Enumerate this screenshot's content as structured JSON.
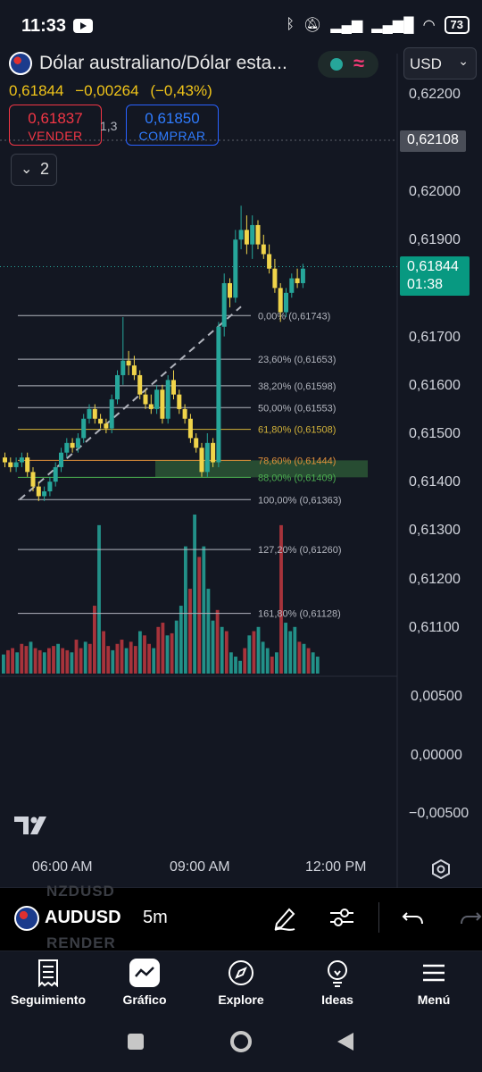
{
  "status_bar": {
    "time": "11:33",
    "battery": "73",
    "icons": [
      "youtube-icon",
      "bluetooth-icon",
      "mute-icon",
      "signal-icon",
      "signal-icon",
      "wifi-icon",
      "battery-icon"
    ]
  },
  "header": {
    "symbol_title": "Dólar australiano/Dólar esta...",
    "currency": "USD",
    "last_price": "0,61844",
    "change": "−0,00264",
    "change_pct": "(−0,43%)",
    "sell_price": "0,61837",
    "sell_label": "VENDER",
    "spread": "1,3",
    "buy_price": "0,61850",
    "buy_label": "COMPRAR",
    "collapsed_count": "2"
  },
  "y_axis": {
    "labels": [
      "0,62200",
      "0,62000",
      "0,61900",
      "0,61700",
      "0,61600",
      "0,61500",
      "0,61400",
      "0,61300",
      "0,61200",
      "0,61100"
    ],
    "marker_grey": "0,62108",
    "marker_price": "0,61844",
    "marker_timer": "01:38",
    "osc_labels": [
      "0,00500",
      "0,00000",
      "−0,00500"
    ]
  },
  "fibonacci": {
    "levels": [
      {
        "label": "0,00% (0,61743)",
        "value": 0.61743,
        "color": "#b2b5be"
      },
      {
        "label": "23,60% (0,61653)",
        "value": 0.61653,
        "color": "#b2b5be"
      },
      {
        "label": "38,20% (0,61598)",
        "value": 0.61598,
        "color": "#b2b5be"
      },
      {
        "label": "50,00% (0,61553)",
        "value": 0.61553,
        "color": "#b2b5be"
      },
      {
        "label": "61,80% (0,61508)",
        "value": 0.61508,
        "color": "#d4b43a"
      },
      {
        "label": "78,60% (0,61444)",
        "value": 0.61444,
        "color": "#e0903a"
      },
      {
        "label": "88,00% (0,61409)",
        "value": 0.61409,
        "color": "#4caf50"
      },
      {
        "label": "100,00% (0,61363)",
        "value": 0.61363,
        "color": "#b2b5be"
      },
      {
        "label": "127,20% (0,61260)",
        "value": 0.6126,
        "color": "#b2b5be"
      },
      {
        "label": "161,80% (0,61128)",
        "value": 0.61128,
        "color": "#b2b5be"
      }
    ]
  },
  "time_axis": [
    "06:00 AM",
    "09:00 AM",
    "12:00 PM"
  ],
  "symbol_bar": {
    "ghost_top": "NZDUSD",
    "symbol": "AUDUSD",
    "ghost_bottom": "RENDER",
    "interval": "5m"
  },
  "nav": {
    "items": [
      {
        "label": "Seguimiento",
        "icon": "watchlist-icon"
      },
      {
        "label": "Gráfico",
        "icon": "chart-icon"
      },
      {
        "label": "Explore",
        "icon": "compass-icon"
      },
      {
        "label": "Ideas",
        "icon": "lightbulb-icon"
      },
      {
        "label": "Menú",
        "icon": "menu-icon"
      }
    ]
  },
  "colors": {
    "up": "#26a69a",
    "down": "#f0d44a",
    "volume_up": "#26a69a",
    "volume_down": "#c2383f",
    "accent": "#2962ff"
  },
  "chart_data": {
    "type": "candlestick",
    "interval": "5m",
    "y_range": [
      0.6106,
      0.6225
    ],
    "candles": [
      [
        0.6145,
        0.6146,
        0.6143,
        0.6144
      ],
      [
        0.6144,
        0.6145,
        0.6142,
        0.6143
      ],
      [
        0.6143,
        0.6145,
        0.6142,
        0.6144
      ],
      [
        0.6144,
        0.6146,
        0.6143,
        0.6145
      ],
      [
        0.6145,
        0.6146,
        0.6141,
        0.6142
      ],
      [
        0.6142,
        0.6143,
        0.6138,
        0.6139
      ],
      [
        0.6139,
        0.614,
        0.6136,
        0.6137
      ],
      [
        0.6137,
        0.6139,
        0.6136,
        0.6138
      ],
      [
        0.6138,
        0.6141,
        0.6137,
        0.614
      ],
      [
        0.614,
        0.6144,
        0.6139,
        0.6143
      ],
      [
        0.6143,
        0.6147,
        0.6142,
        0.6146
      ],
      [
        0.6146,
        0.6149,
        0.6145,
        0.6148
      ],
      [
        0.6148,
        0.6149,
        0.6146,
        0.6147
      ],
      [
        0.6147,
        0.615,
        0.6146,
        0.6149
      ],
      [
        0.6149,
        0.6154,
        0.6148,
        0.6153
      ],
      [
        0.6153,
        0.6156,
        0.6152,
        0.6155
      ],
      [
        0.6155,
        0.6156,
        0.6152,
        0.6153
      ],
      [
        0.6153,
        0.6154,
        0.6151,
        0.6152
      ],
      [
        0.6152,
        0.6153,
        0.615,
        0.6151
      ],
      [
        0.6151,
        0.6158,
        0.615,
        0.6157
      ],
      [
        0.6157,
        0.6163,
        0.6156,
        0.6162
      ],
      [
        0.6162,
        0.6174,
        0.616,
        0.6165
      ],
      [
        0.6165,
        0.6167,
        0.6162,
        0.6164
      ],
      [
        0.6164,
        0.6166,
        0.6161,
        0.6162
      ],
      [
        0.6162,
        0.6163,
        0.6157,
        0.6158
      ],
      [
        0.6158,
        0.6159,
        0.6155,
        0.6156
      ],
      [
        0.6156,
        0.6158,
        0.6154,
        0.6155
      ],
      [
        0.6155,
        0.616,
        0.6154,
        0.6159
      ],
      [
        0.6159,
        0.616,
        0.6152,
        0.6153
      ],
      [
        0.6153,
        0.6162,
        0.6152,
        0.6161
      ],
      [
        0.6161,
        0.6163,
        0.6157,
        0.6158
      ],
      [
        0.6158,
        0.6159,
        0.6154,
        0.6155
      ],
      [
        0.6155,
        0.6156,
        0.6152,
        0.6153
      ],
      [
        0.6153,
        0.6154,
        0.6148,
        0.6149
      ],
      [
        0.6149,
        0.615,
        0.6146,
        0.6147
      ],
      [
        0.6147,
        0.6148,
        0.6141,
        0.6142
      ],
      [
        0.6142,
        0.615,
        0.6141,
        0.6148
      ],
      [
        0.6148,
        0.6149,
        0.6143,
        0.6144
      ],
      [
        0.6144,
        0.6173,
        0.6143,
        0.6172
      ],
      [
        0.6172,
        0.6183,
        0.617,
        0.6181
      ],
      [
        0.6181,
        0.6182,
        0.6176,
        0.6178
      ],
      [
        0.6178,
        0.6192,
        0.6177,
        0.619
      ],
      [
        0.619,
        0.6197,
        0.6188,
        0.6192
      ],
      [
        0.6192,
        0.6195,
        0.6187,
        0.6189
      ],
      [
        0.6189,
        0.6195,
        0.6186,
        0.6193
      ],
      [
        0.6193,
        0.6194,
        0.6188,
        0.6189
      ],
      [
        0.6189,
        0.6191,
        0.6186,
        0.6187
      ],
      [
        0.6187,
        0.6189,
        0.6183,
        0.6184
      ],
      [
        0.6184,
        0.6186,
        0.6179,
        0.618
      ],
      [
        0.618,
        0.6181,
        0.6173,
        0.6175
      ],
      [
        0.6175,
        0.618,
        0.6174,
        0.6179
      ],
      [
        0.6179,
        0.6183,
        0.6178,
        0.6182
      ],
      [
        0.6182,
        0.6184,
        0.618,
        0.6181
      ],
      [
        0.6181,
        0.6185,
        0.618,
        0.6184
      ]
    ],
    "volume": [
      9,
      11,
      12,
      10,
      14,
      13,
      15,
      12,
      11,
      10,
      12,
      13,
      14,
      12,
      11,
      10,
      16,
      12,
      15,
      14,
      32,
      70,
      20,
      13,
      11,
      14,
      16,
      12,
      15,
      13,
      20,
      18,
      14,
      12,
      22,
      24,
      18,
      19,
      25,
      32,
      60,
      40,
      75,
      55,
      60,
      40,
      25,
      30,
      22,
      20,
      10,
      8,
      6,
      12,
      18,
      20,
      22,
      15,
      12,
      8,
      10,
      70,
      24,
      20,
      22,
      15,
      14,
      12,
      10,
      8
    ],
    "volume_max": 75
  }
}
